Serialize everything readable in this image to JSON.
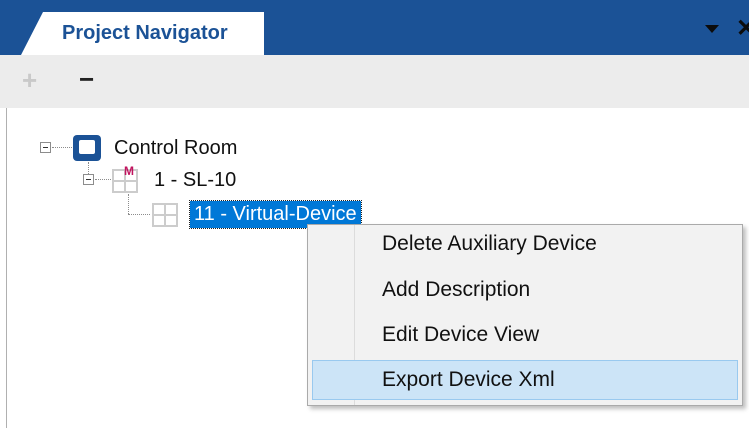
{
  "window": {
    "tab_title": "Project Navigator",
    "menu_icon": "dropdown-triangle-icon",
    "close_icon": "close-icon",
    "close_glyph": "✕",
    "accent_color": "#1b5296"
  },
  "toolbar": {
    "add_glyph": "+",
    "add_enabled": false,
    "remove_glyph": "−",
    "remove_enabled": true
  },
  "tree": {
    "root": {
      "label": "Control Room",
      "icon": "control-room-icon",
      "expanded": true
    },
    "child": {
      "label": "1 - SL-10",
      "icon": "device-grid-icon",
      "badge": "M",
      "expanded": true
    },
    "grandchild": {
      "label": "11 - Virtual-Device",
      "icon": "device-grid-icon",
      "selected": true
    }
  },
  "context_menu": {
    "items": [
      {
        "label": "Delete Auxiliary Device"
      },
      {
        "label": "Add Description"
      },
      {
        "label": "Edit Device View"
      },
      {
        "label": "Export Device Xml",
        "highlighted": true
      }
    ],
    "highlight_color": "#cce4f7"
  }
}
